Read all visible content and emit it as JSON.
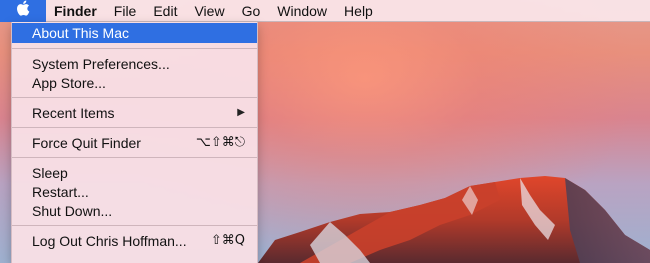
{
  "menubar": {
    "apple_icon": "apple-logo-icon",
    "items": [
      {
        "label": "Finder"
      },
      {
        "label": "File"
      },
      {
        "label": "Edit"
      },
      {
        "label": "View"
      },
      {
        "label": "Go"
      },
      {
        "label": "Window"
      },
      {
        "label": "Help"
      }
    ]
  },
  "apple_menu": {
    "about": "About This Mac",
    "system_preferences": "System Preferences...",
    "app_store": "App Store...",
    "recent_items": "Recent Items",
    "recent_items_arrow": "▶",
    "force_quit": "Force Quit Finder",
    "force_quit_shortcut": "⌥⇧⌘⎋",
    "sleep": "Sleep",
    "restart": "Restart...",
    "shut_down": "Shut Down...",
    "log_out": "Log Out Chris Hoffman...",
    "log_out_shortcut": "⇧⌘Q"
  },
  "colors": {
    "accent": "#2f6fe2",
    "menu_background": "#f8dfe5"
  }
}
